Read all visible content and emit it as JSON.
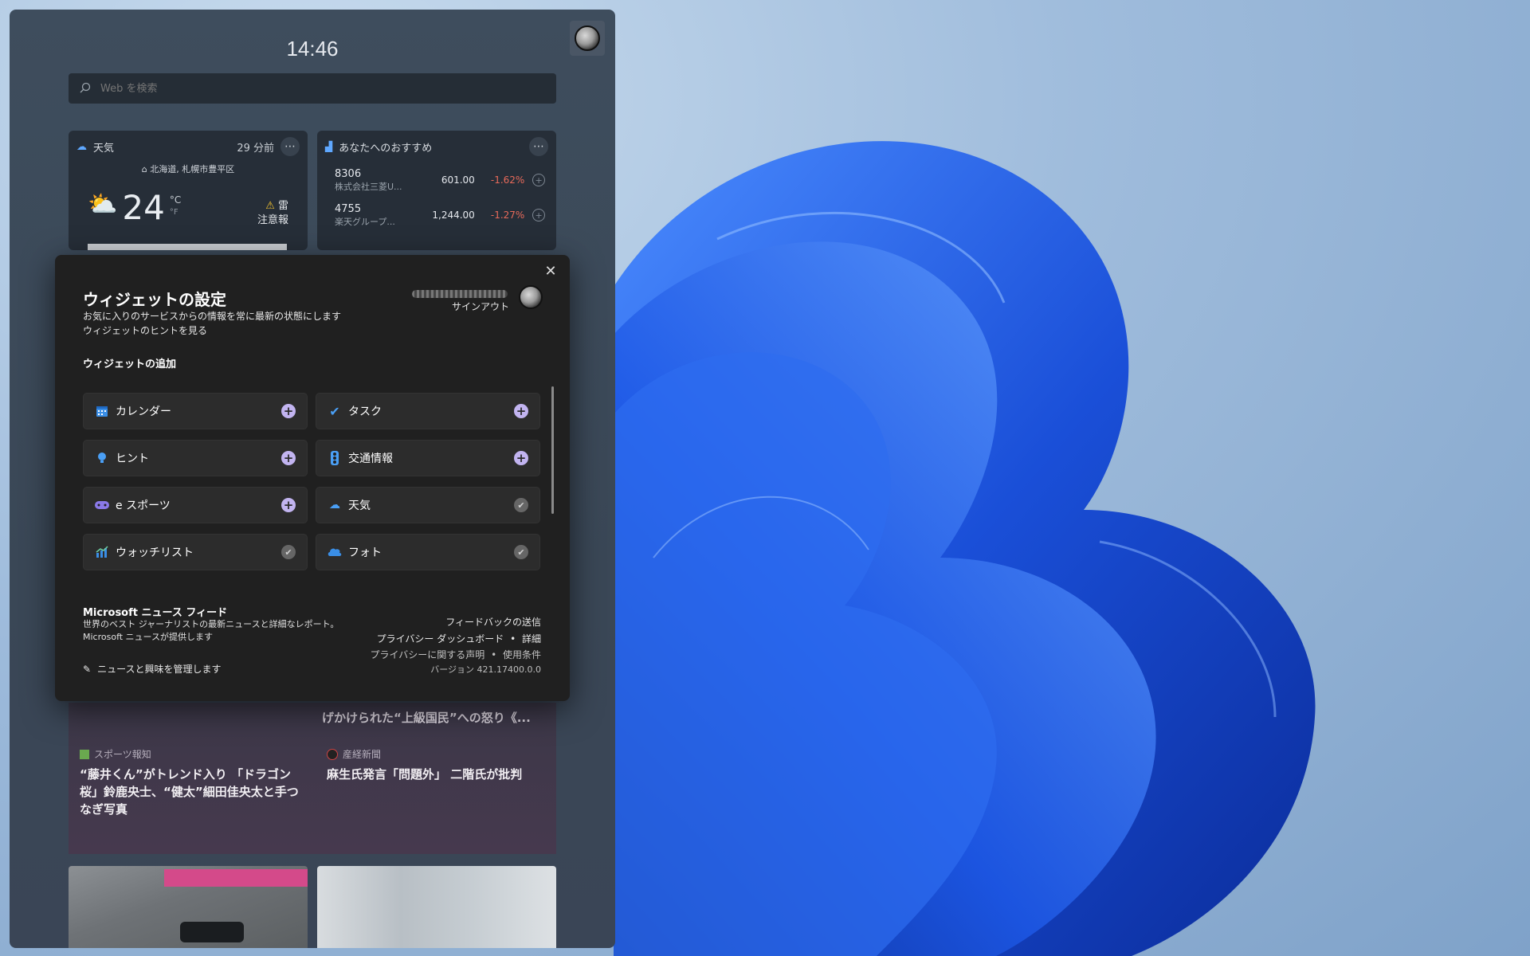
{
  "clock": "14:46",
  "search": {
    "placeholder": "Web を検索"
  },
  "weather_card": {
    "title": "天気",
    "updated": "29 分前",
    "location": "北海道, 札幌市豊平区",
    "temperature": "24",
    "unit_c": "°C",
    "unit_f": "°F",
    "alert_line1": "雷",
    "alert_line2": "注意報"
  },
  "stocks_card": {
    "title": "あなたへのおすすめ",
    "rows": [
      {
        "code": "8306",
        "name": "株式会社三菱U...",
        "price": "601.00",
        "change": "-1.62%"
      },
      {
        "code": "4755",
        "name": "楽天グループ...",
        "price": "1,244.00",
        "change": "-1.27%"
      }
    ]
  },
  "news": {
    "partial_title": "げかけられた“上級国民”への怒り《...",
    "items": [
      {
        "source": "スポーツ報知",
        "title": "“藤井くん”がトレンド入り 「ドラゴン桜」鈴鹿央士、“健太”細田佳央太と手つなぎ写真"
      },
      {
        "source": "産経新聞",
        "title": "麻生氏発言「問題外」 二階氏が批判"
      }
    ]
  },
  "settings": {
    "title": "ウィジェットの設定",
    "subtitle": "お気に入りのサービスからの情報を常に最新の状態にします",
    "tips_link": "ウィジェットのヒントを見る",
    "signout": "サインアウト",
    "add_label": "ウィジェットの追加",
    "widgets": [
      {
        "label": "カレンダー",
        "state": "add"
      },
      {
        "label": "タスク",
        "state": "add"
      },
      {
        "label": "ヒント",
        "state": "add"
      },
      {
        "label": "交通情報",
        "state": "add"
      },
      {
        "label": "e スポーツ",
        "state": "add"
      },
      {
        "label": "天気",
        "state": "added"
      },
      {
        "label": "ウォッチリスト",
        "state": "added"
      },
      {
        "label": "フォト",
        "state": "added"
      }
    ],
    "feed_title": "Microsoft ニュース フィード",
    "feed_desc": "世界のベスト ジャーナリストの最新ニュースと詳細なレポート。Microsoft ニュースが提供します",
    "manage": "ニュースと興味を管理します",
    "feedback": "フィードバックの送信",
    "privacy_dashboard": "プライバシー ダッシュボード",
    "details": "詳細",
    "privacy_statement": "プライバシーに関する声明",
    "terms": "使用条件",
    "version": "バージョン 421.17400.0.0",
    "separator": "•"
  },
  "colors": {
    "accent_plus": "#c2b4f0",
    "negative": "#e86a5a",
    "wallpaper_blue": "#1f5fe0"
  },
  "icons": [
    "search-icon",
    "weather-icon",
    "stocks-icon",
    "more-icon",
    "close-icon",
    "calendar-icon",
    "todo-icon",
    "tips-icon",
    "traffic-icon",
    "esports-icon",
    "photos-icon",
    "watchlist-icon",
    "pencil-icon"
  ]
}
